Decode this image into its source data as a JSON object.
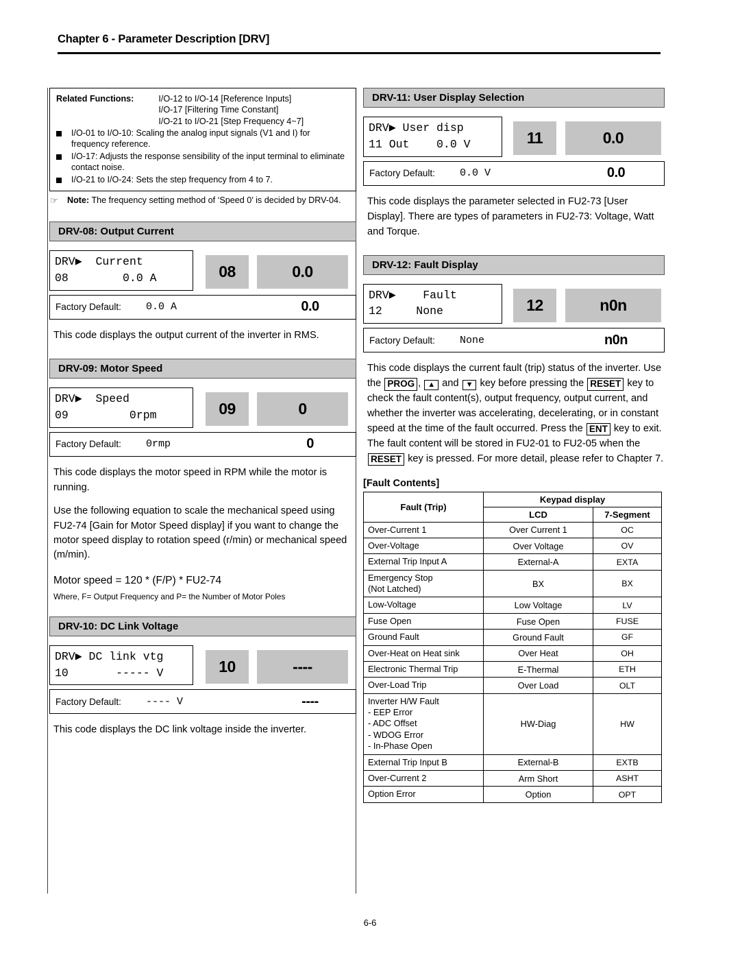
{
  "header": {
    "chapter_title": "Chapter 6 - Parameter Description [DRV]"
  },
  "footer": {
    "page_number": "6-6"
  },
  "related_functions": {
    "label": "Related Functions:",
    "values": [
      "I/O-12 to I/O-14 [Reference Inputs]",
      "I/O-17 [Filtering Time Constant]",
      "I/O-21 to I/O-21 [Step Frequency 4~7]"
    ],
    "bullets": [
      "I/O-01 to I/O-10: Scaling the analog input signals (V1 and I) for frequency reference.",
      "I/O-17: Adjusts the response sensibility of the input terminal to eliminate contact noise.",
      "I/O-21 to I/O-24: Sets the step frequency from 4 to 7."
    ]
  },
  "note": {
    "hand_icon": "pointing-hand-icon",
    "bold_label": "Note:",
    "text": " The frequency setting method of ‘Speed 0’ is decided by DRV-04."
  },
  "drv08": {
    "heading": "DRV-08: Output Current",
    "lcd_line1": "DRV▶  Current",
    "lcd_line2": "08        0.0 A",
    "badge_code": "08",
    "badge_value": "0.0",
    "factory_label": "Factory Default:",
    "factory_value": "0.0 A",
    "factory_seg": "0.0",
    "description": "This code displays the output current of the inverter in RMS."
  },
  "drv09": {
    "heading": "DRV-09: Motor Speed",
    "lcd_line1": "DRV▶  Speed",
    "lcd_line2": "09         0rpm",
    "badge_code": "09",
    "badge_value": "0",
    "factory_label": "Factory Default:",
    "factory_value": "0rmp",
    "factory_seg": "0",
    "description1": "This code displays the motor speed in RPM while the motor is running.",
    "description2": "Use the following equation to scale the mechanical speed using FU2-74 [Gain for Motor Speed display] if you want to change the motor speed display to rotation speed (r/min) or mechanical speed (m/min).",
    "equation": "Motor speed = 120 * (F/P) * FU2-74",
    "equation_where": "Where, F= Output Frequency and P= the Number of Motor Poles"
  },
  "drv10": {
    "heading": "DRV-10: DC Link Voltage",
    "lcd_line1": "DRV▶ DC link vtg",
    "lcd_line2": "10       ----- V",
    "badge_code": "10",
    "badge_value": "----",
    "factory_label": "Factory Default:",
    "factory_value": "---- V",
    "factory_seg": "----",
    "description": "This code displays the DC link voltage inside the inverter."
  },
  "drv11": {
    "heading": "DRV-11: User Display Selection",
    "lcd_line1": "DRV▶ User disp",
    "lcd_line2": "11 Out    0.0 V",
    "badge_code": "11",
    "badge_value": "0.0",
    "factory_label": "Factory Default:",
    "factory_value": "0.0 V",
    "factory_seg": "0.0",
    "description": "This code displays the parameter selected in FU2-73 [User Display]. There are types of parameters in FU2-73: Voltage, Watt and Torque."
  },
  "drv12": {
    "heading": "DRV-12: Fault Display",
    "lcd_line1": "DRV▶    Fault",
    "lcd_line2": "12     None",
    "badge_code": "12",
    "badge_value": "n0n",
    "factory_label": "Factory Default:",
    "factory_value": "None",
    "factory_seg": "n0n",
    "desc_p1": "This code displays the current fault (trip) status of the inverter. Use the ",
    "key_prog": "PROG",
    "desc_p2": ", ",
    "key_up": "▲",
    "desc_p3": " and ",
    "key_down": "▼",
    "desc_p4": " key before pressing the ",
    "key_reset1": "RESET",
    "desc_p5": " key to check the fault content(s), output frequency, output current, and whether the inverter was accelerating, decelerating, or in constant speed at the time of the fault occurred. Press the ",
    "key_ent": "ENT",
    "desc_p6": " key to exit. The fault content will be stored in FU2-01 to FU2-05 when the ",
    "key_reset2": "RESET",
    "desc_p7": " key is pressed. For more detail, please refer to Chapter 7."
  },
  "fault_contents": {
    "title": "[Fault Contents]",
    "col_fault": "Fault (Trip)",
    "col_keypad": "Keypad display",
    "col_lcd": "LCD",
    "col_seg": "7-Segment",
    "rows": [
      {
        "fault": "Over-Current 1",
        "lcd": "Over Current 1",
        "seg": "OC"
      },
      {
        "fault": "Over-Voltage",
        "lcd": "Over Voltage",
        "seg": "OV"
      },
      {
        "fault": "External Trip Input A",
        "lcd": "External-A",
        "seg": "EXTA"
      },
      {
        "fault": "Emergency Stop\n(Not Latched)",
        "lcd": "BX",
        "seg": "BX"
      },
      {
        "fault": "Low-Voltage",
        "lcd": "Low Voltage",
        "seg": "LV"
      },
      {
        "fault": "Fuse Open",
        "lcd": "Fuse Open",
        "seg": "FUSE"
      },
      {
        "fault": "Ground Fault",
        "lcd": "Ground Fault",
        "seg": "GF"
      },
      {
        "fault": "Over-Heat on Heat sink",
        "lcd": "Over Heat",
        "seg": "OH"
      },
      {
        "fault": "Electronic Thermal Trip",
        "lcd": "E-Thermal",
        "seg": "ETH"
      },
      {
        "fault": "Over-Load Trip",
        "lcd": "Over Load",
        "seg": "OLT"
      },
      {
        "fault": "Inverter H/W Fault\n- EEP Error\n- ADC Offset\n- WDOG Error\n- In-Phase Open",
        "lcd": "HW-Diag",
        "seg": "HW"
      },
      {
        "fault": "External Trip Input B",
        "lcd": "External-B",
        "seg": "EXTB"
      },
      {
        "fault": "Over-Current 2",
        "lcd": "Arm Short",
        "seg": "ASHT"
      },
      {
        "fault": "Option Error",
        "lcd": "Option",
        "seg": "OPT"
      }
    ]
  },
  "colors": {
    "heading_bar": "#c9c9c9",
    "badge": "#c4c4c4",
    "text": "#000000"
  }
}
